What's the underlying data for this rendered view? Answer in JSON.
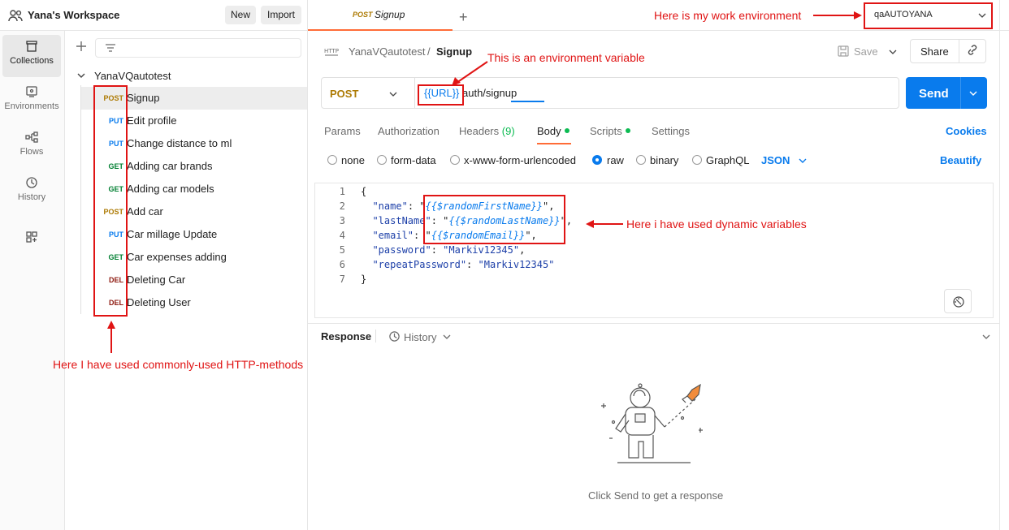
{
  "workspace": {
    "title": "Yana's Workspace",
    "new_label": "New",
    "import_label": "Import"
  },
  "rail": [
    {
      "label": "Collections",
      "icon": "collections-icon"
    },
    {
      "label": "Environments",
      "icon": "environments-icon"
    },
    {
      "label": "Flows",
      "icon": "flows-icon"
    },
    {
      "label": "History",
      "icon": "history-icon"
    }
  ],
  "collection": {
    "name": "YanaVQautotest",
    "requests": [
      {
        "method": "POST",
        "label": "Signup",
        "color": "#ad7a03"
      },
      {
        "method": "PUT",
        "label": "Edit profile",
        "color": "#097bed"
      },
      {
        "method": "PUT",
        "label": "Change distance to ml",
        "color": "#097bed"
      },
      {
        "method": "GET",
        "label": "Adding car brands",
        "color": "#007f31"
      },
      {
        "method": "GET",
        "label": "Adding car models",
        "color": "#007f31"
      },
      {
        "method": "POST",
        "label": "Add car",
        "color": "#ad7a03"
      },
      {
        "method": "PUT",
        "label": "Car millage Update",
        "color": "#097bed"
      },
      {
        "method": "GET",
        "label": "Car expenses adding",
        "color": "#007f31"
      },
      {
        "method": "DEL",
        "label": "Deleting Car",
        "color": "#8e1a10"
      },
      {
        "method": "DEL",
        "label": "Deleting User",
        "color": "#8e1a10"
      }
    ]
  },
  "tab": {
    "method": "POST",
    "name": "Signup"
  },
  "environment": {
    "selected": "qaAUTOYANA"
  },
  "breadcrumb": {
    "collection": "YanaVQautotest",
    "separator": "/",
    "request": "Signup"
  },
  "toolbar": {
    "save_label": "Save",
    "share_label": "Share"
  },
  "request": {
    "method": "POST",
    "url_variable": "{{URL}}",
    "url_path": "auth/signup",
    "send_label": "Send"
  },
  "request_tabs": {
    "params": "Params",
    "authorization": "Authorization",
    "headers": "Headers",
    "headers_count": "(9)",
    "body": "Body",
    "scripts": "Scripts",
    "settings": "Settings",
    "cookies": "Cookies"
  },
  "body_types": {
    "none": "none",
    "form_data": "form-data",
    "urlencoded": "x-www-form-urlencoded",
    "raw": "raw",
    "binary": "binary",
    "graphql": "GraphQL",
    "selected_format": "JSON",
    "beautify": "Beautify"
  },
  "editor": {
    "line_numbers": [
      "1",
      "2",
      "3",
      "4",
      "5",
      "6",
      "7"
    ],
    "open_brace": "{",
    "close_brace": "}",
    "fields": [
      {
        "key": "\"name\"",
        "value": "{{$randomFirstName}}",
        "dynamic": true
      },
      {
        "key": "\"lastName\"",
        "value": "{{$randomLastName}}",
        "dynamic": true
      },
      {
        "key": "\"email\"",
        "value": "{{$randomEmail}}",
        "dynamic": true
      },
      {
        "key": "\"password\"",
        "value": "\"Markiv12345\"",
        "dynamic": false
      },
      {
        "key": "\"repeatPassword\"",
        "value": "\"Markiv12345\"",
        "dynamic": false
      }
    ]
  },
  "response": {
    "label": "Response",
    "history_label": "History",
    "empty_text": "Click Send to get a response"
  },
  "annotations": {
    "work_env": "Here is my work environment",
    "env_var": "This is an environment variable",
    "dynamic_vars": "Here i have used dynamic variables",
    "http_methods": "Here I have used commonly-used HTTP-methods",
    "color": "#e01414"
  }
}
